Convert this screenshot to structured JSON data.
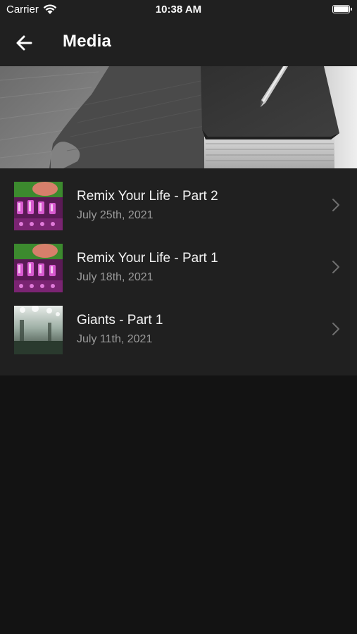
{
  "status_bar": {
    "carrier": "Carrier",
    "time": "10:38 AM",
    "wifi_icon": "wifi-icon",
    "battery_icon": "battery-icon"
  },
  "nav": {
    "title": "Media",
    "back_icon": "arrow-left-icon"
  },
  "banner": {
    "image": "desk-book-pen-photo"
  },
  "media_items": [
    {
      "title": "Remix Your Life - Part 2",
      "date": "July 25th, 2021",
      "thumbnail": "mixing-console-photo",
      "chevron_icon": "chevron-right-icon"
    },
    {
      "title": "Remix Your Life - Part 1",
      "date": "July 18th, 2021",
      "thumbnail": "mixing-console-photo",
      "chevron_icon": "chevron-right-icon"
    },
    {
      "title": "Giants - Part 1",
      "date": "July 11th, 2021",
      "thumbnail": "forest-photo",
      "chevron_icon": "chevron-right-icon"
    }
  ],
  "colors": {
    "background": "#131313",
    "surface": "#202020",
    "primary_text": "#f2f2f2",
    "secondary_text": "#9a9a9a",
    "chevron": "#6f6f6f"
  }
}
